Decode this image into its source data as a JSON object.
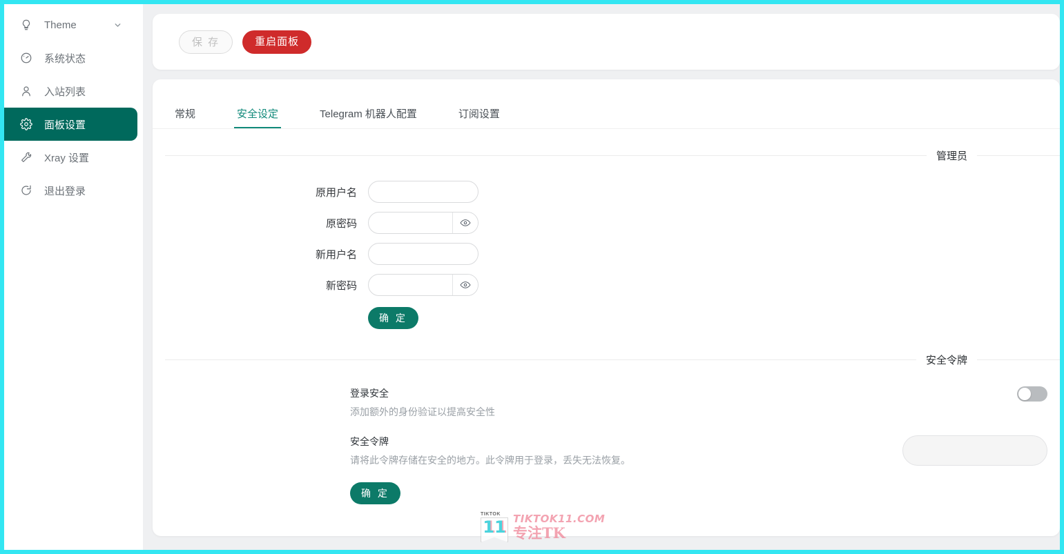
{
  "sidebar": {
    "items": [
      {
        "label": "Theme",
        "icon": "bulb-icon",
        "active": false,
        "has_chevron": true
      },
      {
        "label": "系统状态",
        "icon": "dashboard-icon",
        "active": false,
        "has_chevron": false
      },
      {
        "label": "入站列表",
        "icon": "user-icon",
        "active": false,
        "has_chevron": false
      },
      {
        "label": "面板设置",
        "icon": "gear-icon",
        "active": true,
        "has_chevron": false
      },
      {
        "label": "Xray 设置",
        "icon": "tool-icon",
        "active": false,
        "has_chevron": false
      },
      {
        "label": "退出登录",
        "icon": "logout-icon",
        "active": false,
        "has_chevron": false
      }
    ]
  },
  "toolbar": {
    "save_label": "保 存",
    "restart_label": "重启面板"
  },
  "tabs": [
    {
      "label": "常规",
      "active": false
    },
    {
      "label": "安全设定",
      "active": true
    },
    {
      "label": "Telegram 机器人配置",
      "active": false
    },
    {
      "label": "订阅设置",
      "active": false
    }
  ],
  "admin_section": {
    "divider_title": "管理员",
    "fields": [
      {
        "label": "原用户名",
        "value": "",
        "placeholder": "",
        "type": "text",
        "suffix_icon": ""
      },
      {
        "label": "原密码",
        "value": "",
        "placeholder": "",
        "type": "password",
        "suffix_icon": "eye-icon"
      },
      {
        "label": "新用户名",
        "value": "",
        "placeholder": "",
        "type": "text",
        "suffix_icon": ""
      },
      {
        "label": "新密码",
        "value": "",
        "placeholder": "",
        "type": "password",
        "suffix_icon": "eye-icon"
      }
    ],
    "confirm_label": "确 定"
  },
  "token_section": {
    "divider_title": "安全令牌",
    "login_security": {
      "title": "登录安全",
      "desc": "添加额外的身份验证以提高安全性",
      "enabled": false
    },
    "security_token": {
      "title": "安全令牌",
      "desc": "请将此令牌存储在安全的地方。此令牌用于登录，丢失无法恢复。",
      "value": "",
      "placeholder": "",
      "disabled": true
    },
    "confirm_label": "确 定"
  },
  "watermark": {
    "badge_tag": "TIKTOK",
    "badge_number": "11",
    "line1": "TIKTOK11.COM",
    "line2": "专注TK"
  },
  "colors": {
    "accent_teal": "#00695c",
    "tab_active": "#10897a",
    "danger_red": "#cf2b2b",
    "frame_cyan": "#33e6f2",
    "page_bg": "#eff0f2"
  }
}
